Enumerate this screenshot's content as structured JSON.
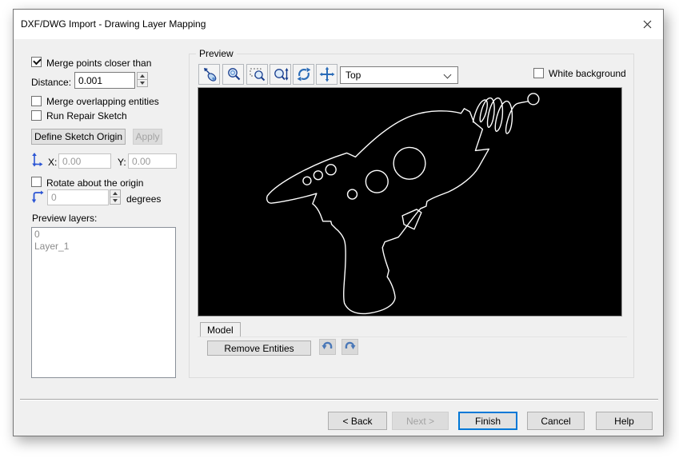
{
  "window": {
    "title": "DXF/DWG Import - Drawing Layer Mapping"
  },
  "left_panel": {
    "merge_points": {
      "label": "Merge points closer than",
      "checked": true
    },
    "distance": {
      "label": "Distance:",
      "value": "0.001"
    },
    "merge_overlapping": {
      "label": "Merge overlapping entities",
      "checked": false
    },
    "run_repair": {
      "label": "Run Repair Sketch",
      "checked": false
    },
    "define_origin_button": "Define Sketch Origin",
    "apply_button": "Apply",
    "x_label": "X:",
    "x_value": "0.00",
    "y_label": "Y:",
    "y_value": "0.00",
    "rotate_about_origin": {
      "label": "Rotate about the origin",
      "checked": false
    },
    "rotation": {
      "value": "0",
      "unit": "degrees"
    },
    "preview_layers_label": "Preview layers:",
    "layers": [
      "0",
      "Layer_1"
    ]
  },
  "preview": {
    "group_label": "Preview",
    "toolbar": {
      "icons": [
        "zoom-to-selection",
        "zoom-in",
        "zoom-to-area",
        "zoom-in-out",
        "rotate-view",
        "pan"
      ],
      "view_selected": "Top",
      "white_background_label": "White background",
      "white_background_checked": false
    },
    "tab_label": "Model",
    "remove_entities_button": "Remove Entities"
  },
  "footer": {
    "back": "< Back",
    "next": "Next >",
    "finish": "Finish",
    "cancel": "Cancel",
    "help": "Help"
  },
  "colors": {
    "accent": "#0078d7",
    "preview_background": "#000000",
    "drawing_line": "#ffffff"
  }
}
